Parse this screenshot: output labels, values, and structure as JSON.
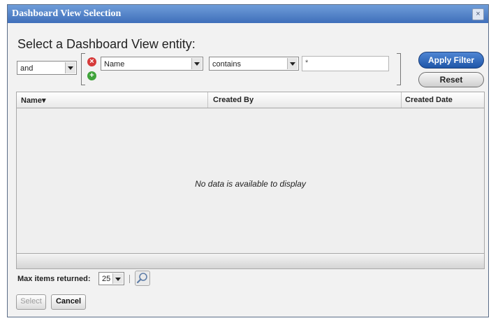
{
  "window": {
    "title": "Dashboard View Selection",
    "close_glyph": "×"
  },
  "heading": "Select a Dashboard View entity:",
  "filter": {
    "logic_value": "and",
    "field_value": "Name",
    "operator_value": "contains",
    "text_value": "*",
    "remove_glyph": "×",
    "add_glyph": "+"
  },
  "buttons": {
    "apply_filter": "Apply Filter",
    "reset": "Reset",
    "select": "Select",
    "cancel": "Cancel"
  },
  "table": {
    "columns": [
      "Name",
      "Created By",
      "Created Date"
    ],
    "sort_indicator": "▾",
    "empty_message": "No data is available to display"
  },
  "pagination": {
    "max_items_label": "Max items returned:",
    "max_items_value": "25"
  },
  "colors": {
    "titlebar": "#3f6fba",
    "apply_button": "#1f56a8",
    "panel_bg": "#f2f2f2"
  }
}
